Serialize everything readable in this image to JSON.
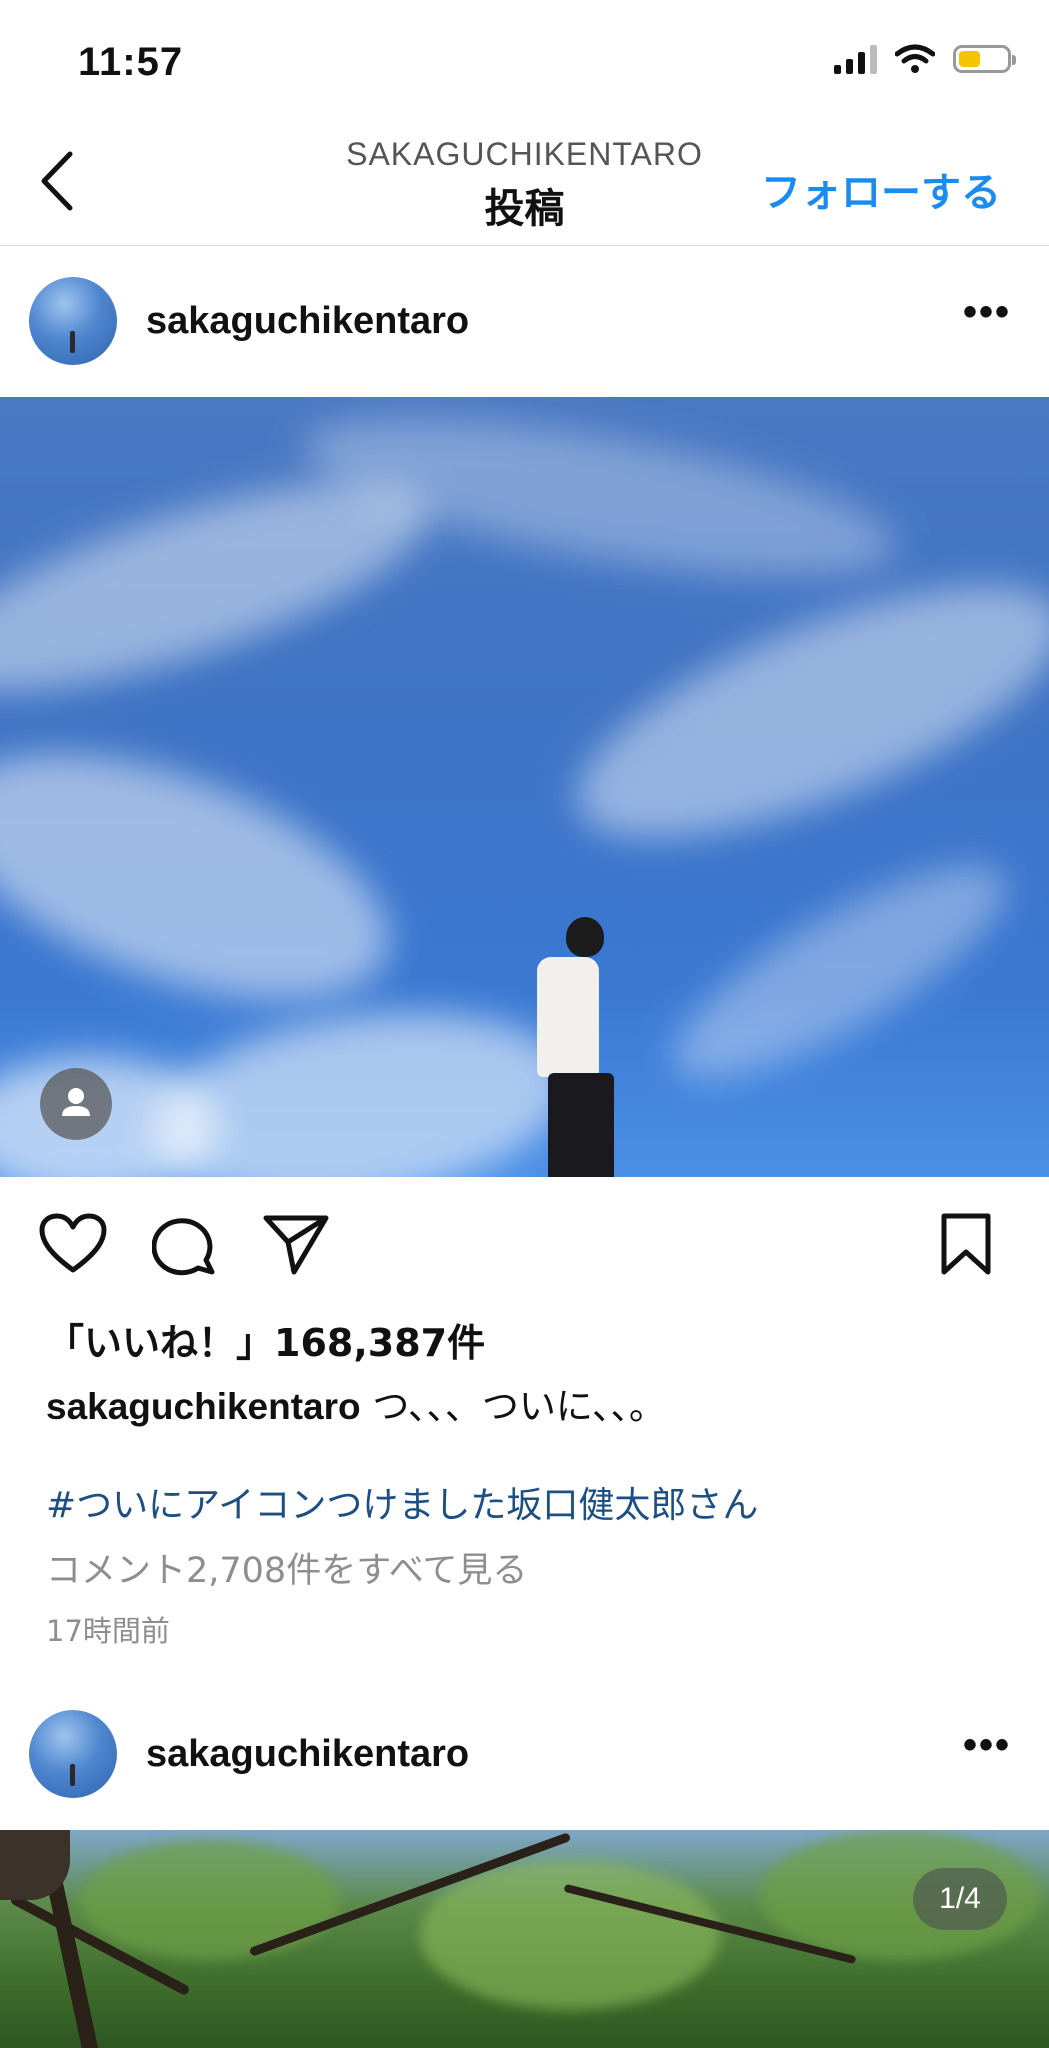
{
  "status_bar": {
    "time": "11:57"
  },
  "header": {
    "account": "SAKAGUCHIKENTARO",
    "title": "投稿",
    "follow_label": "フォローする"
  },
  "posts": [
    {
      "username": "sakaguchikentaro",
      "likes_text": "「いいね！」168,387件",
      "caption_user": "sakaguchikentaro",
      "caption_text": "つ、、、ついに、、。",
      "hashtag": "#ついにアイコンつけました坂口健太郎さん",
      "comments_link": "コメント2,708件をすべて見る",
      "time_ago": "17時間前"
    },
    {
      "username": "sakaguchikentaro",
      "carousel_counter": "1/4"
    }
  ],
  "colors": {
    "accent": "#1a8cf0",
    "hashtag": "#1d4f84",
    "muted": "#8e8e8e"
  }
}
